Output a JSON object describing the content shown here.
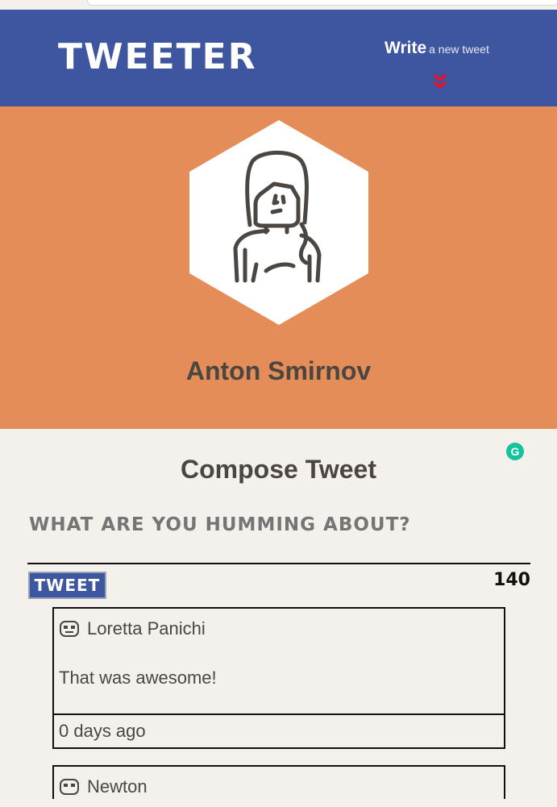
{
  "nav": {
    "brand": "TWEETER",
    "write_label": "Write",
    "write_rest": "a new tweet"
  },
  "profile": {
    "name": "Anton Smirnov"
  },
  "compose": {
    "title": "Compose Tweet",
    "placeholder": "What are you humming about?",
    "button_label": "Tweet",
    "counter": "140"
  },
  "tweets": [
    {
      "author": "Loretta Panichi",
      "text": "That was awesome!",
      "age": "0 days ago"
    },
    {
      "author": "Newton"
    }
  ],
  "colors": {
    "nav_bg": "#3e55a0",
    "profile_bg": "#e48d58",
    "page_bg": "#f4f1ec",
    "text": "#4b4642",
    "chevron": "#e8102a",
    "grammarly": "#15c39a"
  },
  "icons": {
    "write_chevron": "double-chevron-down-icon",
    "avatar": "woman-avatar-icon",
    "grammarly": "grammarly-icon",
    "tweet_avatar": "pixel-face-icon"
  }
}
